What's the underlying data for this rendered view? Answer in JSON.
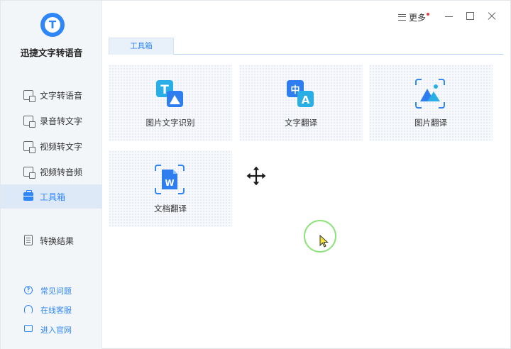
{
  "app": {
    "name": "迅捷文字转语音",
    "logo_letter": "T"
  },
  "colors": {
    "accent": "#2f86f6",
    "sidebar_bg": "#f3f6f9",
    "active_bg": "#dde9f7"
  },
  "sidebar": {
    "items": [
      {
        "label": "文字转语音",
        "icon": "text-to-speech-icon",
        "active": false
      },
      {
        "label": "录音转文字",
        "icon": "recording-to-text-icon",
        "active": false
      },
      {
        "label": "视频转文字",
        "icon": "video-to-text-icon",
        "active": false
      },
      {
        "label": "视频转音频",
        "icon": "video-to-audio-icon",
        "active": false
      },
      {
        "label": "工具箱",
        "icon": "toolbox-icon",
        "active": true
      },
      {
        "label": "转换结果",
        "icon": "result-icon",
        "active": false
      }
    ],
    "footer": [
      {
        "label": "常见问题",
        "icon": "help-icon"
      },
      {
        "label": "在线客服",
        "icon": "headset-icon"
      },
      {
        "label": "进入官网",
        "icon": "monitor-icon"
      }
    ]
  },
  "titlebar": {
    "more_label": "更多"
  },
  "tabs": [
    {
      "label": "工具箱",
      "active": true
    }
  ],
  "tools": [
    {
      "label": "图片文字识别",
      "icon": "image-text-recognition-icon",
      "glyph": "T"
    },
    {
      "label": "文字翻译",
      "icon": "text-translate-icon",
      "glyph_a": "中",
      "glyph_b": "A"
    },
    {
      "label": "图片翻译",
      "icon": "image-translate-icon"
    },
    {
      "label": "文档翻译",
      "icon": "document-translate-icon",
      "glyph": "W"
    }
  ]
}
